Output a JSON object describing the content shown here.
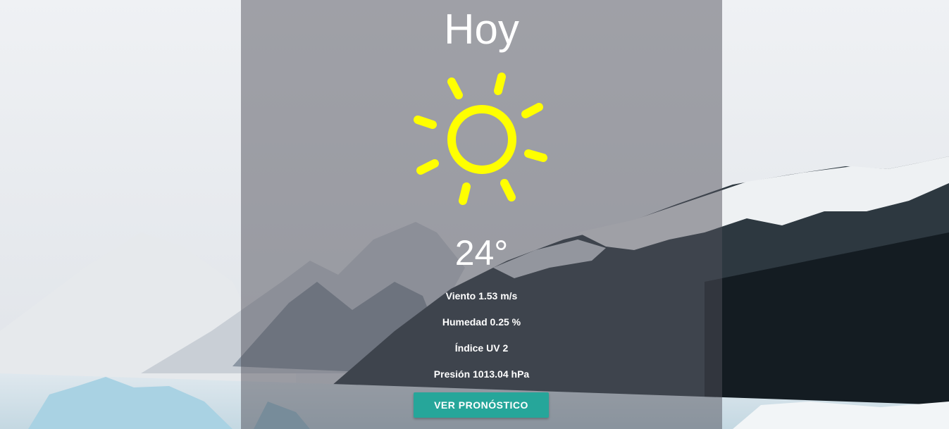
{
  "day_title": "Hoy",
  "weather_icon": "sun-icon",
  "temperature": "24°",
  "stats": {
    "wind": "Viento 1.53 m/s",
    "humidity": "Humedad 0.25 %",
    "uv_index": "Índice UV 2",
    "pressure": "Presión 1013.04 hPa"
  },
  "forecast_button": "VER PRONÓSTICO",
  "colors": {
    "sun": "#ffff00",
    "button": "#26a69a",
    "text": "#ffffff"
  }
}
